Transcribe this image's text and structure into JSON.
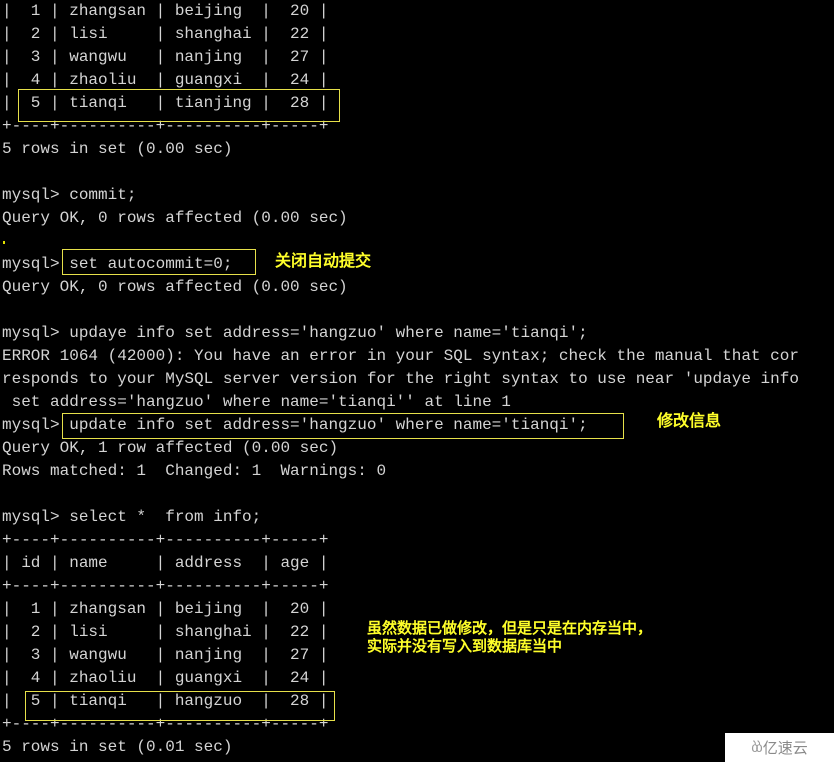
{
  "terminal": {
    "lines": [
      "|  1 | zhangsan | beijing  |  20 |",
      "|  2 | lisi     | shanghai |  22 |",
      "|  3 | wangwu   | nanjing  |  27 |",
      "|  4 | zhaoliu  | guangxi  |  24 |",
      "|  5 | tianqi   | tianjing |  28 |",
      "+----+----------+----------+-----+",
      "5 rows in set (0.00 sec)",
      "",
      "mysql> commit;",
      "Query OK, 0 rows affected (0.00 sec)",
      "",
      "mysql> set autocommit=0;",
      "Query OK, 0 rows affected (0.00 sec)",
      "",
      "mysql> updaye info set address='hangzuo' where name='tianqi';",
      "ERROR 1064 (42000): You have an error in your SQL syntax; check the manual that cor",
      "responds to your MySQL server version for the right syntax to use near 'updaye info",
      " set address='hangzuo' where name='tianqi'' at line 1",
      "mysql> update info set address='hangzuo' where name='tianqi';",
      "Query OK, 1 row affected (0.00 sec)",
      "Rows matched: 1  Changed: 1  Warnings: 0",
      "",
      "mysql> select *  from info;",
      "+----+----------+----------+-----+",
      "| id | name     | address  | age |",
      "+----+----------+----------+-----+",
      "|  1 | zhangsan | beijing  |  20 |",
      "|  2 | lisi     | shanghai |  22 |",
      "|  3 | wangwu   | nanjing  |  27 |",
      "|  4 | zhaoliu  | guangxi  |  24 |",
      "|  5 | tianqi   | hangzuo  |  28 |",
      "+----+----------+----------+-----+",
      "5 rows in set (0.01 sec)"
    ]
  },
  "annotations": {
    "autocommit_note": "关闭自动提交",
    "update_note": "修改信息",
    "memory_note_line1": "虽然数据已做修改，但是只是在内存当中，",
    "memory_note_line2": "实际并没有写入到数据库当中"
  },
  "watermark": {
    "logo": "ბბ",
    "text": "亿速云"
  },
  "colors": {
    "background": "#000000",
    "text": "#d4d4d4",
    "highlight": "#e6e04a",
    "annotation": "#ffff2a"
  }
}
